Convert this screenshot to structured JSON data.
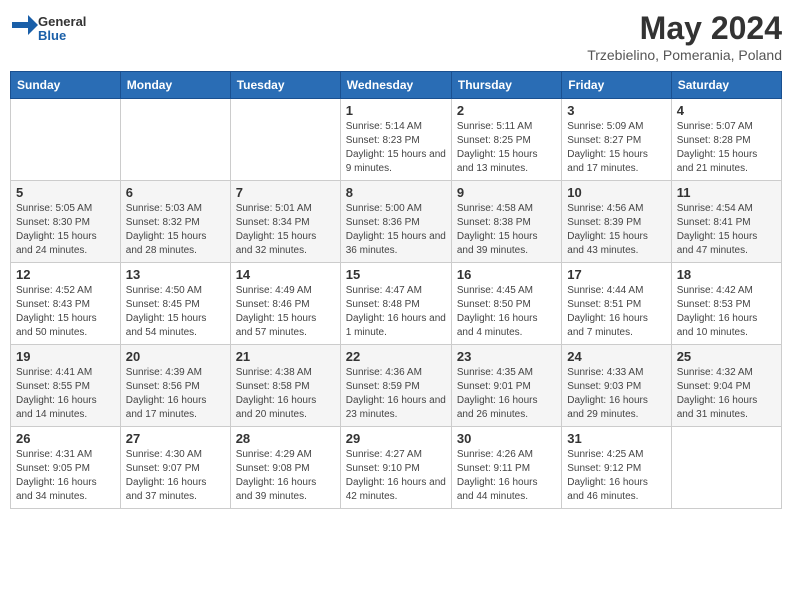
{
  "logo": {
    "general": "General",
    "blue": "Blue"
  },
  "title": "May 2024",
  "subtitle": "Trzebielino, Pomerania, Poland",
  "days_of_week": [
    "Sunday",
    "Monday",
    "Tuesday",
    "Wednesday",
    "Thursday",
    "Friday",
    "Saturday"
  ],
  "weeks": [
    [
      {
        "day": "",
        "info": ""
      },
      {
        "day": "",
        "info": ""
      },
      {
        "day": "",
        "info": ""
      },
      {
        "day": "1",
        "info": "Sunrise: 5:14 AM\nSunset: 8:23 PM\nDaylight: 15 hours and 9 minutes."
      },
      {
        "day": "2",
        "info": "Sunrise: 5:11 AM\nSunset: 8:25 PM\nDaylight: 15 hours and 13 minutes."
      },
      {
        "day": "3",
        "info": "Sunrise: 5:09 AM\nSunset: 8:27 PM\nDaylight: 15 hours and 17 minutes."
      },
      {
        "day": "4",
        "info": "Sunrise: 5:07 AM\nSunset: 8:28 PM\nDaylight: 15 hours and 21 minutes."
      }
    ],
    [
      {
        "day": "5",
        "info": "Sunrise: 5:05 AM\nSunset: 8:30 PM\nDaylight: 15 hours and 24 minutes."
      },
      {
        "day": "6",
        "info": "Sunrise: 5:03 AM\nSunset: 8:32 PM\nDaylight: 15 hours and 28 minutes."
      },
      {
        "day": "7",
        "info": "Sunrise: 5:01 AM\nSunset: 8:34 PM\nDaylight: 15 hours and 32 minutes."
      },
      {
        "day": "8",
        "info": "Sunrise: 5:00 AM\nSunset: 8:36 PM\nDaylight: 15 hours and 36 minutes."
      },
      {
        "day": "9",
        "info": "Sunrise: 4:58 AM\nSunset: 8:38 PM\nDaylight: 15 hours and 39 minutes."
      },
      {
        "day": "10",
        "info": "Sunrise: 4:56 AM\nSunset: 8:39 PM\nDaylight: 15 hours and 43 minutes."
      },
      {
        "day": "11",
        "info": "Sunrise: 4:54 AM\nSunset: 8:41 PM\nDaylight: 15 hours and 47 minutes."
      }
    ],
    [
      {
        "day": "12",
        "info": "Sunrise: 4:52 AM\nSunset: 8:43 PM\nDaylight: 15 hours and 50 minutes."
      },
      {
        "day": "13",
        "info": "Sunrise: 4:50 AM\nSunset: 8:45 PM\nDaylight: 15 hours and 54 minutes."
      },
      {
        "day": "14",
        "info": "Sunrise: 4:49 AM\nSunset: 8:46 PM\nDaylight: 15 hours and 57 minutes."
      },
      {
        "day": "15",
        "info": "Sunrise: 4:47 AM\nSunset: 8:48 PM\nDaylight: 16 hours and 1 minute."
      },
      {
        "day": "16",
        "info": "Sunrise: 4:45 AM\nSunset: 8:50 PM\nDaylight: 16 hours and 4 minutes."
      },
      {
        "day": "17",
        "info": "Sunrise: 4:44 AM\nSunset: 8:51 PM\nDaylight: 16 hours and 7 minutes."
      },
      {
        "day": "18",
        "info": "Sunrise: 4:42 AM\nSunset: 8:53 PM\nDaylight: 16 hours and 10 minutes."
      }
    ],
    [
      {
        "day": "19",
        "info": "Sunrise: 4:41 AM\nSunset: 8:55 PM\nDaylight: 16 hours and 14 minutes."
      },
      {
        "day": "20",
        "info": "Sunrise: 4:39 AM\nSunset: 8:56 PM\nDaylight: 16 hours and 17 minutes."
      },
      {
        "day": "21",
        "info": "Sunrise: 4:38 AM\nSunset: 8:58 PM\nDaylight: 16 hours and 20 minutes."
      },
      {
        "day": "22",
        "info": "Sunrise: 4:36 AM\nSunset: 8:59 PM\nDaylight: 16 hours and 23 minutes."
      },
      {
        "day": "23",
        "info": "Sunrise: 4:35 AM\nSunset: 9:01 PM\nDaylight: 16 hours and 26 minutes."
      },
      {
        "day": "24",
        "info": "Sunrise: 4:33 AM\nSunset: 9:03 PM\nDaylight: 16 hours and 29 minutes."
      },
      {
        "day": "25",
        "info": "Sunrise: 4:32 AM\nSunset: 9:04 PM\nDaylight: 16 hours and 31 minutes."
      }
    ],
    [
      {
        "day": "26",
        "info": "Sunrise: 4:31 AM\nSunset: 9:05 PM\nDaylight: 16 hours and 34 minutes."
      },
      {
        "day": "27",
        "info": "Sunrise: 4:30 AM\nSunset: 9:07 PM\nDaylight: 16 hours and 37 minutes."
      },
      {
        "day": "28",
        "info": "Sunrise: 4:29 AM\nSunset: 9:08 PM\nDaylight: 16 hours and 39 minutes."
      },
      {
        "day": "29",
        "info": "Sunrise: 4:27 AM\nSunset: 9:10 PM\nDaylight: 16 hours and 42 minutes."
      },
      {
        "day": "30",
        "info": "Sunrise: 4:26 AM\nSunset: 9:11 PM\nDaylight: 16 hours and 44 minutes."
      },
      {
        "day": "31",
        "info": "Sunrise: 4:25 AM\nSunset: 9:12 PM\nDaylight: 16 hours and 46 minutes."
      },
      {
        "day": "",
        "info": ""
      }
    ]
  ]
}
